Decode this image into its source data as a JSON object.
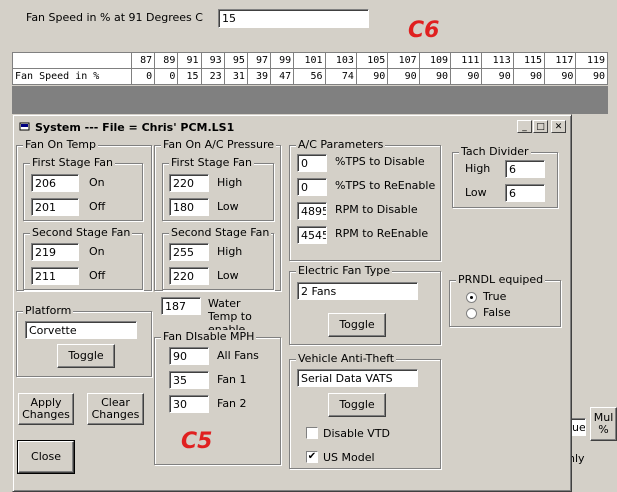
{
  "background": {
    "fan_speed_label": "Fan Speed in %  at 91 Degrees C",
    "fan_speed_value": "15",
    "table": {
      "header": [
        "",
        "87",
        "89",
        "91",
        "93",
        "95",
        "97",
        "99",
        "101",
        "103",
        "105",
        "107",
        "109",
        "111",
        "113",
        "115",
        "117",
        "119"
      ],
      "row_label": "Fan Speed in %",
      "row_values": [
        "0",
        "0",
        "15",
        "23",
        "31",
        "39",
        "47",
        "56",
        "74",
        "90",
        "90",
        "90",
        "90",
        "90",
        "90",
        "90",
        "90"
      ]
    },
    "right_partial_field": "ue",
    "right_partial_button": "Mul %",
    "right_partial_label": "nly"
  },
  "annotations": {
    "c6": "C6",
    "c5": "C5"
  },
  "dialog": {
    "title": "System --- File = Chris' PCM.LS1",
    "fan_on_temp": {
      "caption": "Fan On Temp",
      "first_stage": {
        "caption": "First Stage Fan",
        "on_value": "206",
        "on_label": "On",
        "off_value": "201",
        "off_label": "Off"
      },
      "second_stage": {
        "caption": "Second Stage Fan",
        "on_value": "219",
        "on_label": "On",
        "off_value": "211",
        "off_label": "Off"
      }
    },
    "platform": {
      "caption": "Platform",
      "value": "Corvette",
      "toggle_label": "Toggle"
    },
    "apply_label": "Apply Changes",
    "clear_label": "Clear Changes",
    "close_label": "Close",
    "fan_on_ac": {
      "caption": "Fan On A/C Pressure",
      "first_stage": {
        "caption": "First Stage Fan",
        "high_value": "220",
        "high_label": "High",
        "low_value": "180",
        "low_label": "Low"
      },
      "second_stage": {
        "caption": "Second Stage Fan",
        "high_value": "255",
        "high_label": "High",
        "low_value": "220",
        "low_label": "Low"
      }
    },
    "water_temp": {
      "value": "187",
      "label": "Water Temp to enable"
    },
    "fan_disable_mph": {
      "caption": "Fan DIsable MPH",
      "all_value": "90",
      "all_label": "All Fans",
      "fan1_value": "35",
      "fan1_label": "Fan 1",
      "fan2_value": "30",
      "fan2_label": "Fan 2"
    },
    "ac_params": {
      "caption": "A/C Parameters",
      "tps_disable_value": "0",
      "tps_disable_label": "%TPS to Disable",
      "tps_reenable_value": "0",
      "tps_reenable_label": "%TPS to ReEnable",
      "rpm_disable_value": "4895",
      "rpm_disable_label": "RPM to Disable",
      "rpm_reenable_value": "4545",
      "rpm_reenable_label": "RPM to ReEnable"
    },
    "electric_fan": {
      "caption": "Electric Fan Type",
      "value": "2 Fans",
      "toggle_label": "Toggle"
    },
    "anti_theft": {
      "caption": "Vehicle Anti-Theft",
      "value": "Serial Data VATS",
      "toggle_label": "Toggle",
      "disable_vtd_label": "Disable VTD",
      "us_model_label": "US Model",
      "us_model_checked": "✔"
    },
    "tach_divider": {
      "caption": "Tach Divider",
      "high_label": "High",
      "high_value": "6",
      "low_label": "Low",
      "low_value": "6"
    },
    "prndl": {
      "caption": "PRNDL equiped",
      "true_label": "True",
      "false_label": "False"
    }
  }
}
